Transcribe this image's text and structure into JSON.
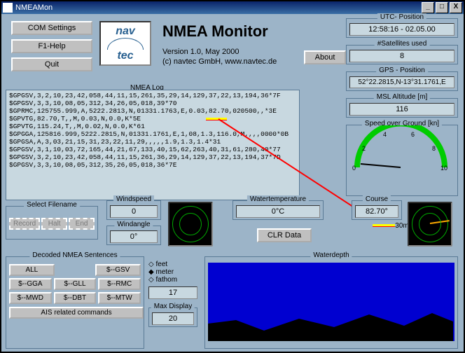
{
  "window": {
    "title": "NMEAMon"
  },
  "buttons": {
    "com": "COM Settings",
    "help": "F1-Help",
    "quit": "Quit",
    "about": "About",
    "clr": "CLR Data",
    "record": "Record",
    "halt": "Halt",
    "end": "End"
  },
  "header": {
    "title": "NMEA Monitor",
    "version": "Version 1.0,  May 2000",
    "copyright": "(c) navtec GmbH,   www.navtec.de",
    "logo_top": "nav",
    "logo_bot": "tec"
  },
  "log": {
    "title": "NMEA Log",
    "lines": [
      "$GPGSV,3,2,10,23,42,058,44,11,15,261,35,29,14,129,37,22,13,194,36*7F",
      "$GPGSV,3,3,10,08,05,312,34,26,05,018,39*70",
      "$GPRMC,125755.999,A,5222.2813,N,01331.1763,E,0.03,82.70,020500,,*3E",
      "$GPVTG,82.70,T,,M,0.03,N,0.0,K*5E",
      "$GPVTG,115.24,T,,M,0.02,N,0.0,K*61",
      "$GPGGA,125816.999,5222.2815,N,01331.1761,E,1,08,1.3,116.0,M,,,,0000*0B",
      "$GPGSA,A,3,03,21,15,31,23,22,11,29,,,,,1.9,1.3,1.4*31",
      "$GPGSV,3,1,10,03,72,165,44,21,67,133,40,15,62,263,40,31,61,280,40*77",
      "$GPGSV,3,2,10,23,42,058,44,11,15,261,36,29,14,129,37,22,13,194,37*7D",
      "$GPGSV,3,3,10,08,05,312,35,26,05,018,36*7E"
    ]
  },
  "status": {
    "utc_label": "UTC- Position",
    "utc_value": "12:58:16  -  02.05.00",
    "sats_label": "#Satellites used",
    "sats_value": "8",
    "gps_label": "GPS - Position",
    "gps_value": "52°22.2815,N-13°31.1761,E",
    "alt_label": "MSL Altitude  [m]",
    "alt_value": "116",
    "sog_label": "Speed over Ground  [kn]",
    "gauge_min": "0",
    "gauge_t1": "2",
    "gauge_t2": "4",
    "gauge_t3": "6",
    "gauge_t4": "8",
    "gauge_max": "10",
    "gauge_sub": "30m"
  },
  "panels": {
    "filename": "Select Filename",
    "wind_label": "Windspeed",
    "wind_value": "0",
    "windang_label": "Windangle",
    "windang_value": "0°",
    "wtemp_label": "Watertemperature",
    "wtemp_value": "0°C",
    "course_label": "Course",
    "course_value": "82.70°",
    "depth_label": "Waterdepth"
  },
  "decoded": {
    "title": "Decoded NMEA Sentences",
    "all": "ALL",
    "gsv": "$--GSV",
    "gga": "$--GGA",
    "gll": "$--GLL",
    "rmc": "$--RMC",
    "mwd": "$--MWD",
    "dbt": "$--DBT",
    "mtw": "$--MTW",
    "ais": "AIS related commands",
    "unit_feet": "feet",
    "unit_meter": "meter",
    "unit_fathom": "fathom",
    "val17": "17",
    "maxdisp_label": "Max Display",
    "maxdisp_value": "20"
  }
}
